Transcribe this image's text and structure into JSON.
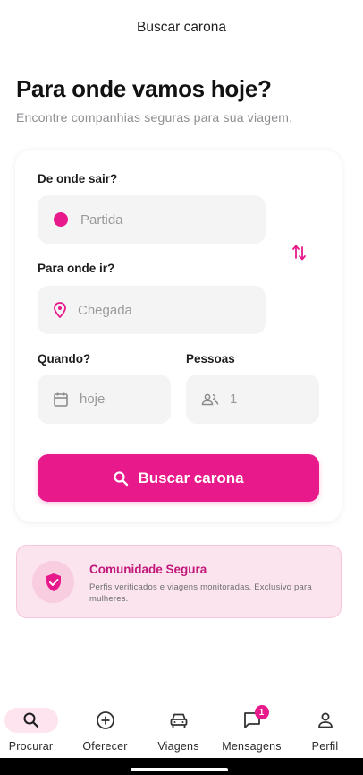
{
  "header": {
    "title": "Buscar carona"
  },
  "hero": {
    "title": "Para onde vamos hoje?",
    "subtitle": "Encontre companhias seguras para sua viagem."
  },
  "search_form": {
    "origin": {
      "label": "De onde sair?",
      "placeholder": "Partida"
    },
    "destination": {
      "label": "Para onde ir?",
      "placeholder": "Chegada"
    },
    "date": {
      "label": "Quando?",
      "value": "hoje"
    },
    "people": {
      "label": "Pessoas",
      "value": "1"
    },
    "submit_label": "Buscar carona"
  },
  "safety_banner": {
    "title": "Comunidade Segura",
    "description": "Perfis verificados e viagens monitoradas. Exclusivo para mulheres."
  },
  "bottom_nav": {
    "items": [
      {
        "label": "Procurar",
        "icon": "search-icon",
        "active": true
      },
      {
        "label": "Oferecer",
        "icon": "add-circle-icon"
      },
      {
        "label": "Viagens",
        "icon": "car-icon"
      },
      {
        "label": "Mensagens",
        "icon": "chat-icon",
        "badge": "1"
      },
      {
        "label": "Perfil",
        "icon": "person-icon"
      }
    ]
  },
  "colors": {
    "accent": "#e8198b",
    "accent_soft": "#fbe4ee",
    "field_bg": "#f4f4f4"
  }
}
